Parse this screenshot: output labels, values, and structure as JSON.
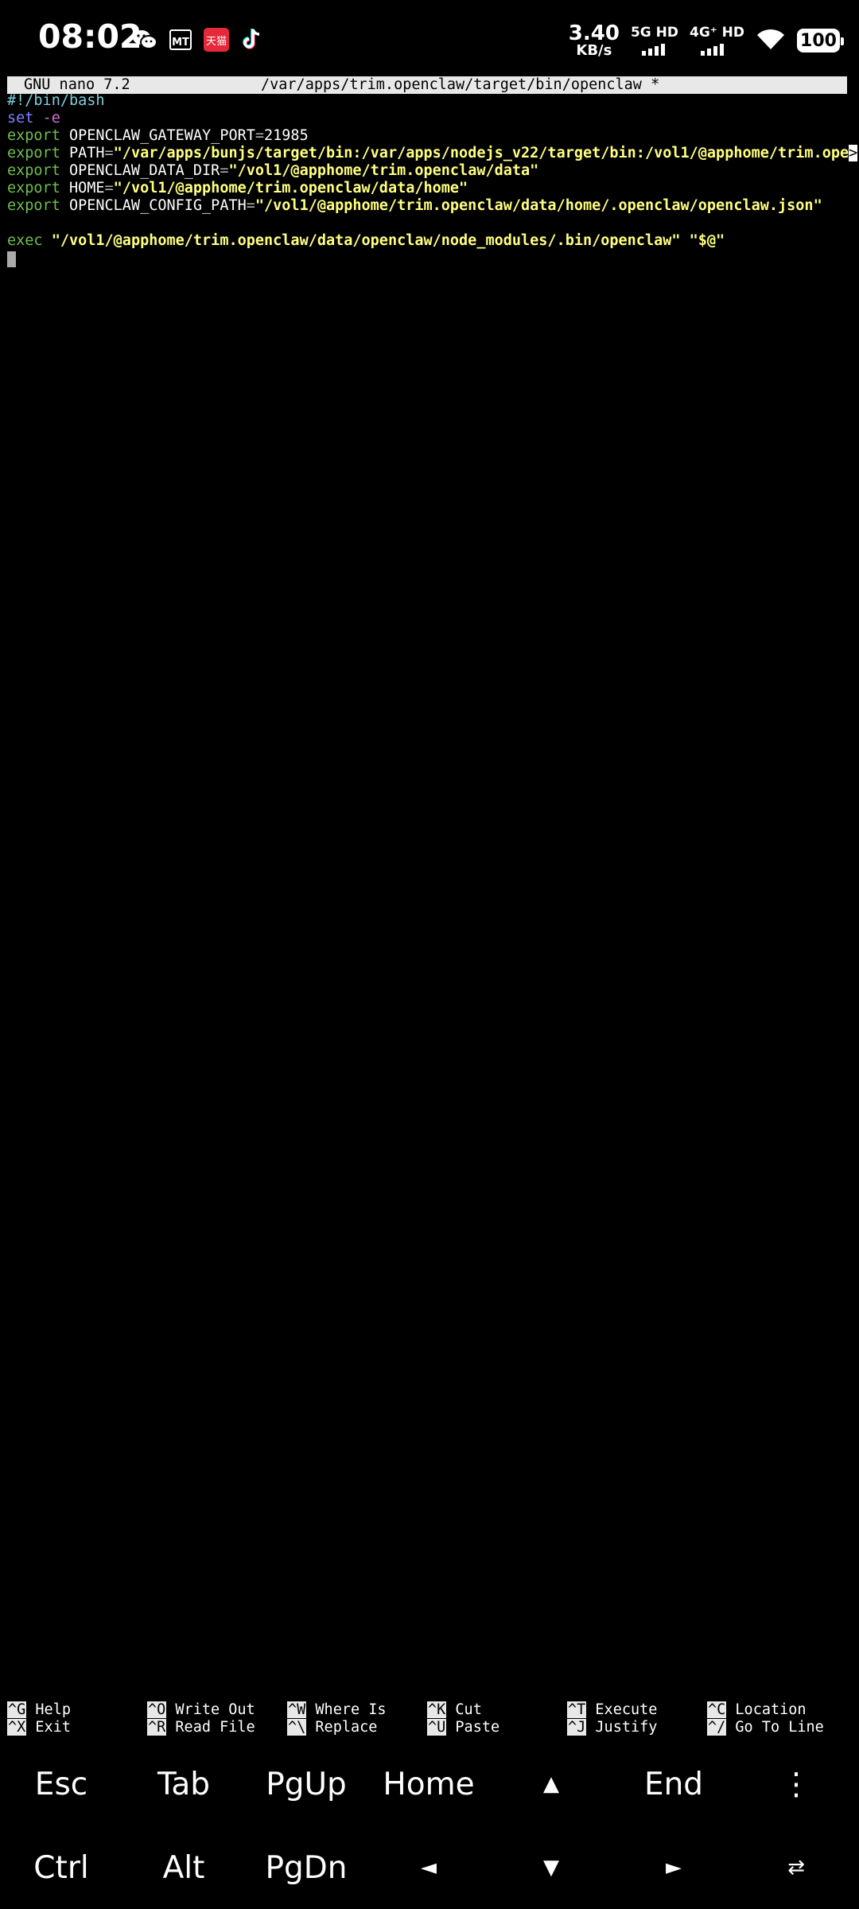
{
  "status_bar": {
    "time": "08:02",
    "apps": [
      "wechat-icon",
      "meituan-icon",
      "tmall-icon",
      "tiktok-icon"
    ],
    "tmall_label": "天猫",
    "meituan_label": "MT",
    "net_speed_value": "3.40",
    "net_speed_unit": "KB/s",
    "sim1_label": "5G HD",
    "sim2_label": "4G⁺ HD",
    "battery": "100"
  },
  "nano": {
    "version": "GNU nano 7.2",
    "filename": "/var/apps/trim.openclaw/target/bin/openclaw *",
    "lines": {
      "shebang": "#!/bin/bash",
      "set_kw": "set",
      "set_flag": "-e",
      "export_kw": "export",
      "l3_var": "OPENCLAW_GATEWAY_PORT",
      "l3_val": "21985",
      "l4_var": "PATH",
      "l4_val": "\"/var/apps/bunjs/target/bin:/var/apps/nodejs_v22/target/bin:/vol1/@apphome/trim.ope",
      "overflow": ">",
      "l5_var": "OPENCLAW_DATA_DIR",
      "l5_val": "\"/vol1/@apphome/trim.openclaw/data\"",
      "l6_var": "HOME",
      "l6_val": "\"/vol1/@apphome/trim.openclaw/data/home\"",
      "l7_var": "OPENCLAW_CONFIG_PATH",
      "l7_val": "\"/vol1/@apphome/trim.openclaw/data/home/.openclaw/openclaw.json\"",
      "exec_kw": "exec",
      "exec_val": "\"/vol1/@apphome/trim.openclaw/data/openclaw/node_modules/.bin/openclaw\" \"$@\""
    },
    "help": [
      {
        "key": "^G",
        "label": "Help"
      },
      {
        "key": "^O",
        "label": "Write Out"
      },
      {
        "key": "^W",
        "label": "Where Is"
      },
      {
        "key": "^K",
        "label": "Cut"
      },
      {
        "key": "^T",
        "label": "Execute"
      },
      {
        "key": "^C",
        "label": "Location"
      },
      {
        "key": "^X",
        "label": "Exit"
      },
      {
        "key": "^R",
        "label": "Read File"
      },
      {
        "key": "^\\",
        "label": "Replace"
      },
      {
        "key": "^U",
        "label": "Paste"
      },
      {
        "key": "^J",
        "label": "Justify"
      },
      {
        "key": "^/",
        "label": "Go To Line"
      }
    ]
  },
  "extra_keys": {
    "row1": [
      "Esc",
      "Tab",
      "PgUp",
      "Home",
      "▲",
      "End",
      "⋮"
    ],
    "row2": [
      "Ctrl",
      "Alt",
      "PgDn",
      "◄",
      "▼",
      "►",
      "⇄"
    ]
  }
}
